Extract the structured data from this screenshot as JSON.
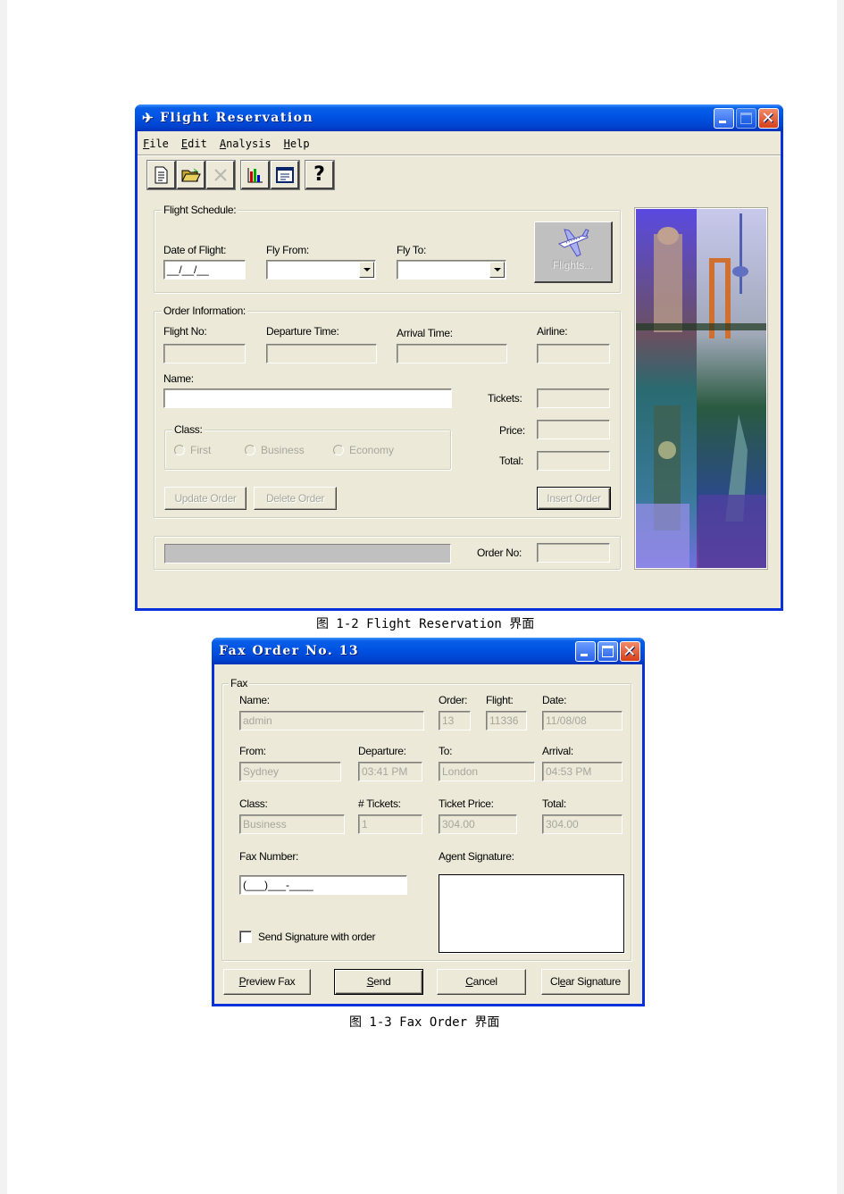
{
  "flight_window": {
    "title": "Flight Reservation",
    "menu": [
      {
        "label": "File",
        "mnemonic": "F"
      },
      {
        "label": "Edit",
        "mnemonic": "E"
      },
      {
        "label": "Analysis",
        "mnemonic": "A"
      },
      {
        "label": "Help",
        "mnemonic": "H"
      }
    ],
    "toolbar": [
      {
        "icon": "new-document-icon",
        "enabled": true
      },
      {
        "icon": "open-folder-icon",
        "enabled": true
      },
      {
        "icon": "delete-x-icon",
        "enabled": false
      },
      {
        "icon": "bar-chart-icon",
        "enabled": true
      },
      {
        "icon": "form-window-icon",
        "enabled": true
      },
      {
        "icon": "help-question-icon",
        "enabled": true
      }
    ],
    "flight_schedule": {
      "group_label": "Flight Schedule:",
      "date_label": "Date of Flight:",
      "date_value": "__/__/__",
      "fly_from_label": "Fly From:",
      "fly_from_value": "",
      "fly_to_label": "Fly To:",
      "fly_to_value": "",
      "flights_button": "Flights..."
    },
    "order_information": {
      "group_label": "Order Information:",
      "flight_no_label": "Flight No:",
      "departure_label": "Departure Time:",
      "arrival_label": "Arrival Time:",
      "airline_label": "Airline:",
      "name_label": "Name:",
      "name_value": "",
      "tickets_label": "Tickets:",
      "price_label": "Price:",
      "total_label": "Total:",
      "class_label": "Class:",
      "class_options": [
        "First",
        "Business",
        "Economy"
      ],
      "update_button": "Update Order",
      "delete_button": "Delete Order",
      "insert_button": "Insert Order"
    },
    "order_no_label": "Order No:",
    "order_no_value": ""
  },
  "caption1": "图 1-2  Flight Reservation 界面",
  "fax_window": {
    "title": "Fax Order No. 13",
    "group_label": "Fax",
    "name_label": "Name:",
    "name_value": "admin",
    "order_label": "Order:",
    "order_value": "13",
    "flight_label": "Flight:",
    "flight_value": "11336",
    "date_label": "Date:",
    "date_value": "11/08/08",
    "from_label": "From:",
    "from_value": "Sydney",
    "departure_label": "Departure:",
    "departure_value": "03:41 PM",
    "to_label": "To:",
    "to_value": "London",
    "arrival_label": "Arrival:",
    "arrival_value": "04:53 PM",
    "class_label": "Class:",
    "class_value": "Business",
    "tickets_label": "# Tickets:",
    "tickets_value": "1",
    "ticket_price_label": "Ticket Price:",
    "ticket_price_value": "304.00",
    "total_label": "Total:",
    "total_value": "304.00",
    "fax_number_label": "Fax Number:",
    "fax_number_value": "(___)___-____",
    "agent_signature_label": "Agent Signature:",
    "send_signature_label": "Send Signature with order",
    "send_signature_checked": false,
    "buttons": {
      "preview": "Preview Fax",
      "send": "Send",
      "cancel": "Cancel",
      "clear": "Clear Signature"
    }
  },
  "caption2": "图 1-3  Fax Order 界面"
}
